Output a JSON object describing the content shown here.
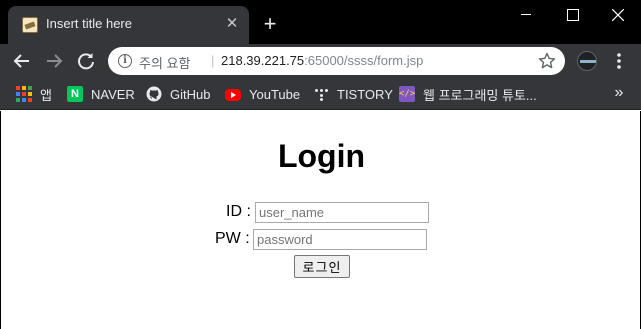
{
  "browser": {
    "tab": {
      "title": "Insert title here"
    },
    "address_bar": {
      "security_label": "주의 요함",
      "host": "218.39.221.75",
      "path": ":65000/ssss/form.jsp"
    },
    "bookmarks": [
      {
        "label": "앱",
        "icon": "apps-grid-icon"
      },
      {
        "label": "NAVER",
        "icon": "naver-icon"
      },
      {
        "label": "GitHub",
        "icon": "github-icon"
      },
      {
        "label": "YouTube",
        "icon": "youtube-icon"
      },
      {
        "label": "TISTORY",
        "icon": "tistory-icon"
      },
      {
        "label": "웹 프로그래밍 튜토...",
        "icon": "web-programming-icon"
      }
    ],
    "bookmarks_overflow": "»",
    "colors": {
      "frame": "#000000",
      "toolbar": "#35363a",
      "omnibox": "#ffffff"
    }
  },
  "page": {
    "title": "Login",
    "id_field": {
      "label": "ID :",
      "placeholder": "user_name"
    },
    "pw_field": {
      "label": "PW :",
      "placeholder": "password"
    },
    "submit_label": "로그인"
  }
}
